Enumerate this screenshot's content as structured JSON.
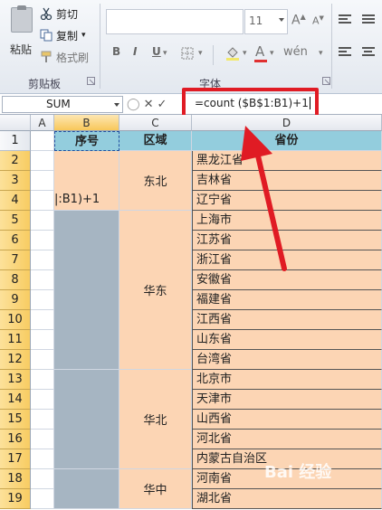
{
  "ribbon": {
    "clipboard": {
      "paste_label": "粘贴",
      "cut_label": "剪切",
      "copy_label": "复制",
      "format_painter_label": "格式刷",
      "group_label": "剪贴板"
    },
    "font": {
      "font_size": "11",
      "bold": "B",
      "italic": "I",
      "underline": "U",
      "group_label": "字体"
    }
  },
  "formula_bar": {
    "name_box": "SUM",
    "formula": "=count ($B$1:B1)+1"
  },
  "columns": [
    "A",
    "B",
    "C",
    "D"
  ],
  "rows": [
    "1",
    "2",
    "3",
    "4",
    "5",
    "6",
    "7",
    "8",
    "9",
    "10",
    "11",
    "12",
    "13",
    "14",
    "15",
    "16",
    "17",
    "18",
    "19"
  ],
  "header": {
    "seq": "序号",
    "region": "区域",
    "province": "省份"
  },
  "editing_cell_text": "|:B1)+1",
  "regions": [
    "东北",
    "华东",
    "华北",
    "华中"
  ],
  "provinces": [
    "黑龙江省",
    "吉林省",
    "辽宁省",
    "上海市",
    "江苏省",
    "浙江省",
    "安徽省",
    "福建省",
    "江西省",
    "山东省",
    "台湾省",
    "北京市",
    "天津市",
    "山西省",
    "河北省",
    "内蒙古自治区",
    "河南省",
    "湖北省"
  ],
  "watermark": "Bai 经验"
}
